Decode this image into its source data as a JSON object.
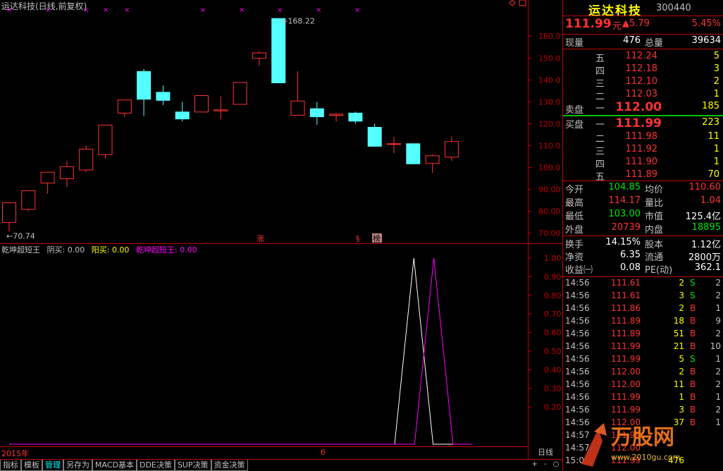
{
  "chart_title": "运达科技(日线,前复权)",
  "indicator": {
    "name": "乾坤超短王",
    "yin_label": "阴买:",
    "yin_value": "0.00",
    "yang_label": "阳买:",
    "yang_value": "0.00",
    "main_label": "乾坤超短王:",
    "main_value": "0.00"
  },
  "x_axis": {
    "year_label": "2015年",
    "month_label": "6"
  },
  "period_label": "日线",
  "nav_buttons": [
    "+",
    "-",
    "○"
  ],
  "tabs": [
    "指标",
    "模板",
    "管理",
    "另存为",
    "MACD基本",
    "DDE决策",
    "SUP决策",
    "资金决策"
  ],
  "markers": {
    "zhang": "涨",
    "s": "§",
    "bang": "榜",
    "xs": [
      "×",
      "×",
      "×",
      "×",
      "×",
      "×",
      "×",
      "×",
      "×",
      "×"
    ]
  },
  "colors": {
    "up": "#ff3232",
    "down": "#54ffff",
    "axis": "#c00000",
    "bg": "#000000",
    "ind_white": "#ffffff",
    "ind_magenta": "#ff00ff"
  },
  "chart_data": [
    {
      "type": "candlestick",
      "price_labels": {
        "high": "168.22",
        "low": "70.74"
      },
      "y_ticks": [
        "160.0",
        "150.0",
        "140.0",
        "130.0",
        "120.0",
        "110.0",
        "100.0",
        "90.00",
        "80.00",
        "70.00"
      ],
      "ylim": [
        66,
        172
      ],
      "candles": [
        {
          "o": 75.0,
          "c": 84.0,
          "h": 84.0,
          "l": 70.74
        },
        {
          "o": 81.0,
          "c": 89.5,
          "h": 89.5,
          "l": 80.0
        },
        {
          "o": 93.0,
          "c": 98.0,
          "h": 98.0,
          "l": 88.0
        },
        {
          "o": 95.0,
          "c": 100.5,
          "h": 103.0,
          "l": 91.0
        },
        {
          "o": 99.0,
          "c": 108.5,
          "h": 110.0,
          "l": 98.0
        },
        {
          "o": 106.0,
          "c": 119.5,
          "h": 119.5,
          "l": 104.0
        },
        {
          "o": 125.0,
          "c": 131.0,
          "h": 131.0,
          "l": 123.0
        },
        {
          "o": 144.0,
          "c": 131.0,
          "h": 145.0,
          "l": 123.5
        },
        {
          "o": 134.5,
          "c": 130.5,
          "h": 137.5,
          "l": 128.5
        },
        {
          "o": 125.5,
          "c": 122.0,
          "h": 130.0,
          "l": 121.0
        },
        {
          "o": 125.5,
          "c": 133.0,
          "h": 133.0,
          "l": 125.5
        },
        {
          "o": 126.0,
          "c": 126.5,
          "h": 132.5,
          "l": 122.0
        },
        {
          "o": 129.0,
          "c": 139.0,
          "h": 139.0,
          "l": 129.0
        },
        {
          "o": 150.0,
          "c": 152.5,
          "h": 153.0,
          "l": 146.5
        },
        {
          "o": 168.22,
          "c": 138.5,
          "h": 168.22,
          "l": 138.5
        },
        {
          "o": 124.0,
          "c": 130.5,
          "h": 144.0,
          "l": 124.0
        },
        {
          "o": 127.0,
          "c": 123.0,
          "h": 130.0,
          "l": 119.5
        },
        {
          "o": 124.0,
          "c": 124.5,
          "h": 125.0,
          "l": 121.0
        },
        {
          "o": 125.0,
          "c": 121.0,
          "h": 125.5,
          "l": 120.0
        },
        {
          "o": 118.5,
          "c": 109.5,
          "h": 120.0,
          "l": 109.5
        },
        {
          "o": 111.0,
          "c": 111.0,
          "h": 114.0,
          "l": 106.5
        },
        {
          "o": 111.0,
          "c": 101.5,
          "h": 111.0,
          "l": 101.5
        },
        {
          "o": 102.0,
          "c": 105.5,
          "h": 106.0,
          "l": 97.5
        },
        {
          "o": 104.85,
          "c": 111.99,
          "h": 114.17,
          "l": 103.0
        }
      ]
    },
    {
      "type": "line",
      "y_ticks": [
        "1.00",
        "0.90",
        "0.80",
        "0.70",
        "0.60",
        "0.50",
        "0.40",
        "0.30",
        "0.20"
      ],
      "ylim": [
        0,
        1
      ],
      "series": [
        {
          "color": "white",
          "values": [
            0,
            0,
            0,
            0,
            0,
            0,
            0,
            0,
            0,
            0,
            0,
            0,
            0,
            0,
            0,
            0,
            0,
            0,
            0,
            0,
            0,
            1,
            0,
            0,
            0
          ]
        },
        {
          "color": "magenta",
          "values": [
            0,
            0,
            0,
            0,
            0,
            0,
            0,
            0,
            0,
            0,
            0,
            0,
            0,
            0,
            0,
            0,
            0,
            0,
            0,
            0,
            0,
            0,
            1,
            0,
            0
          ]
        }
      ]
    }
  ],
  "quote": {
    "name": "运达科技",
    "code": "300440",
    "price": "111.99",
    "unit": "元",
    "change": "▲5.79",
    "pct": "5.45%",
    "xianliang_label": "现量",
    "xianliang": "476",
    "zongliang_label": "总量",
    "zongliang": "39634",
    "sell_label": "卖盘",
    "buy_label": "买盘",
    "asks": [
      {
        "level": "五",
        "price": "112.24",
        "vol": "5"
      },
      {
        "level": "四",
        "price": "112.18",
        "vol": "3"
      },
      {
        "level": "三",
        "price": "112.10",
        "vol": "2"
      },
      {
        "level": "二",
        "price": "112.03",
        "vol": "1"
      },
      {
        "level": "一",
        "price": "112.00",
        "vol": "185"
      }
    ],
    "bids": [
      {
        "level": "一",
        "price": "111.99",
        "vol": "223"
      },
      {
        "level": "二",
        "price": "111.98",
        "vol": "11"
      },
      {
        "level": "三",
        "price": "111.92",
        "vol": "1"
      },
      {
        "level": "四",
        "price": "111.90",
        "vol": "1"
      },
      {
        "level": "五",
        "price": "111.89",
        "vol": "70"
      }
    ],
    "stats": [
      {
        "l1": "今开",
        "v1": "104.85",
        "c1": "green",
        "l2": "均价",
        "v2": "110.60",
        "c2": "red"
      },
      {
        "l1": "最高",
        "v1": "114.17",
        "c1": "red",
        "l2": "量比",
        "v2": "1.04",
        "c2": "red"
      },
      {
        "l1": "最低",
        "v1": "103.00",
        "c1": "green",
        "l2": "市值",
        "v2": "125.4亿",
        "c2": "white"
      },
      {
        "l1": "外盘",
        "v1": "20739",
        "c1": "red",
        "l2": "内盘",
        "v2": "18895",
        "c2": "green"
      }
    ],
    "fund": [
      {
        "l1": "换手",
        "v1": "14.15%",
        "l2": "股本",
        "v2": "1.12亿"
      },
      {
        "l1": "净资",
        "v1": "6.35",
        "l2": "流通",
        "v2": "2800万"
      },
      {
        "l1": "收益㈠",
        "v1": "0.08",
        "l2": "PE(动)",
        "v2": "362.1"
      }
    ],
    "ticks": [
      {
        "t": "14:56",
        "p": "111.61",
        "v": "2",
        "bs": "S",
        "n": "2"
      },
      {
        "t": "14:56",
        "p": "111.61",
        "v": "3",
        "bs": "S",
        "n": "2"
      },
      {
        "t": "14:56",
        "p": "111.86",
        "v": "2",
        "bs": "B",
        "n": "1"
      },
      {
        "t": "14:56",
        "p": "111.89",
        "v": "18",
        "bs": "B",
        "n": "9"
      },
      {
        "t": "14:56",
        "p": "111.89",
        "v": "51",
        "bs": "B",
        "n": "2"
      },
      {
        "t": "14:56",
        "p": "111.99",
        "v": "21",
        "bs": "B",
        "n": "10"
      },
      {
        "t": "14:56",
        "p": "111.99",
        "v": "5",
        "bs": "S",
        "n": "1"
      },
      {
        "t": "14:56",
        "p": "112.00",
        "v": "2",
        "bs": "B",
        "n": "2"
      },
      {
        "t": "14:56",
        "p": "112.00",
        "v": "11",
        "bs": "B",
        "n": "2"
      },
      {
        "t": "14:56",
        "p": "111.99",
        "v": "1",
        "bs": "B",
        "n": "1"
      },
      {
        "t": "14:56",
        "p": "111.99",
        "v": "3",
        "bs": "B",
        "n": "2"
      },
      {
        "t": "14:56",
        "p": "112.00",
        "v": "37",
        "bs": "B",
        "n": "1"
      },
      {
        "t": "14:57",
        "p": "111.99",
        "v": "",
        "bs": "",
        "n": ""
      },
      {
        "t": "14:57",
        "p": "112.00",
        "v": "",
        "bs": "",
        "n": ""
      },
      {
        "t": "15:0",
        "p": "111.99",
        "v": "476",
        "bs": "",
        "n": ""
      }
    ],
    "watermark": {
      "brand": "万股网",
      "url": "www.2010gu.com"
    }
  }
}
